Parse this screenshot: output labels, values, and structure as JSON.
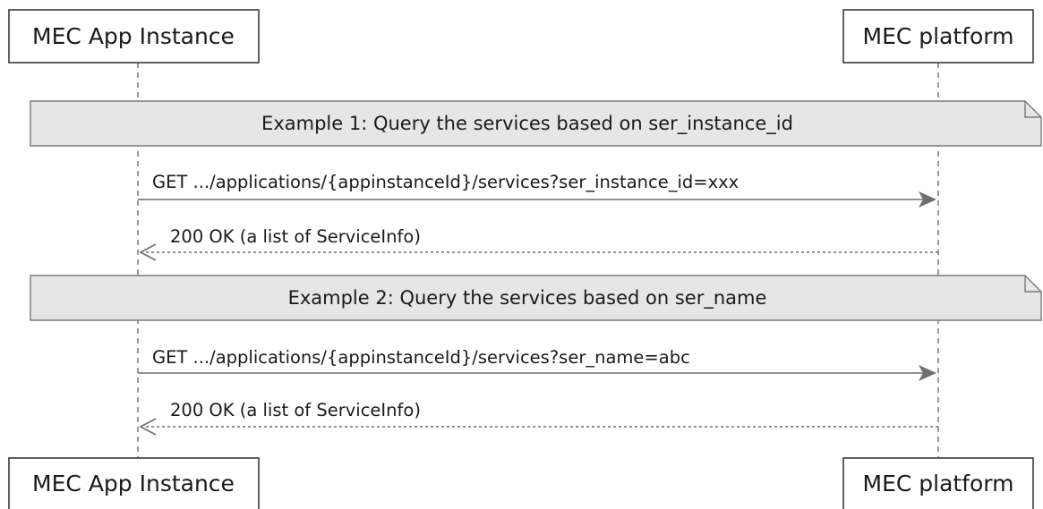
{
  "participants": {
    "left": {
      "name": "MEC App Instance"
    },
    "right": {
      "name": "MEC platform"
    }
  },
  "notes": [
    {
      "text": "Example 1: Query the services based on ser_instance_id"
    },
    {
      "text": "Example 2: Query the services based on ser_name"
    }
  ],
  "messages": [
    {
      "text": "GET .../applications/{appinstanceId}/services?ser_instance_id=xxx",
      "from": "left",
      "to": "right",
      "style": "solid"
    },
    {
      "text": "200 OK (a list of ServiceInfo)",
      "from": "right",
      "to": "left",
      "style": "dashed"
    },
    {
      "text": "GET .../applications/{appinstanceId}/services?ser_name=abc",
      "from": "left",
      "to": "right",
      "style": "solid"
    },
    {
      "text": "200 OK (a list of ServiceInfo)",
      "from": "right",
      "to": "left",
      "style": "dashed"
    }
  ]
}
